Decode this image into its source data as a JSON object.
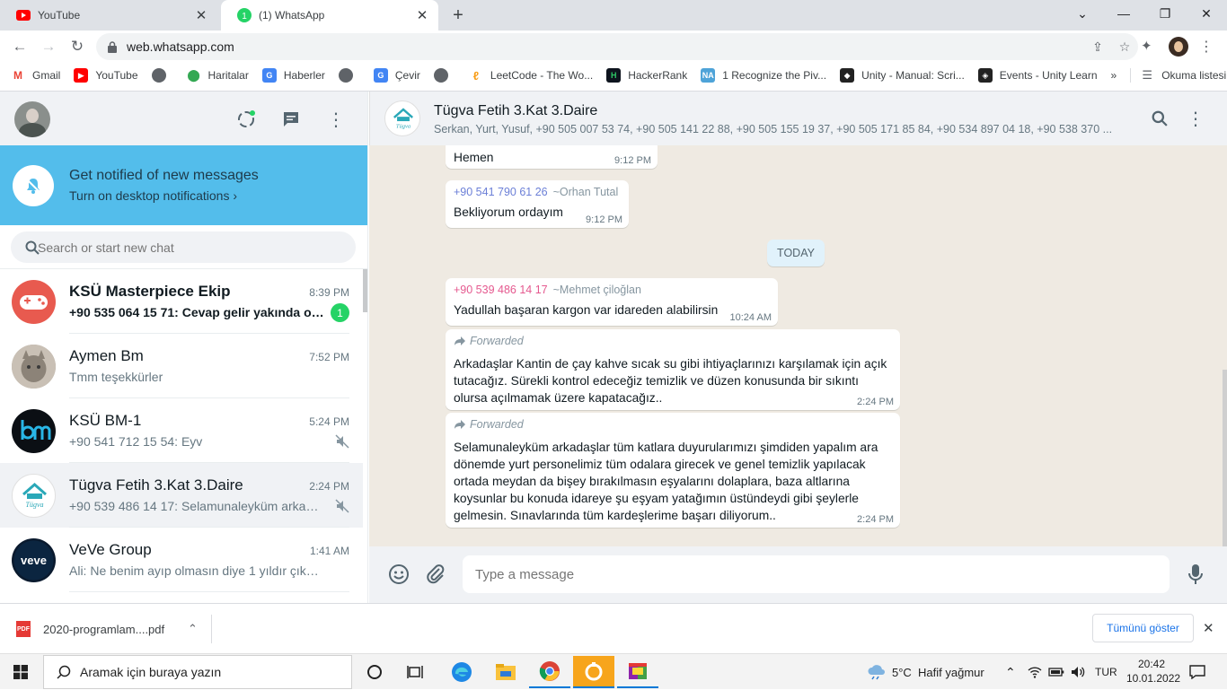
{
  "browser": {
    "tabs": [
      {
        "title": "YouTube",
        "active": false
      },
      {
        "title": "(1) WhatsApp",
        "active": true
      }
    ],
    "url": "web.whatsapp.com",
    "bookmarks": [
      {
        "label": "Gmail",
        "icon": "gmail-icon"
      },
      {
        "label": "YouTube",
        "icon": "youtube-icon"
      },
      {
        "label": "",
        "icon": "globe-icon"
      },
      {
        "label": "Haritalar",
        "icon": "maps-icon"
      },
      {
        "label": "Haberler",
        "icon": "news-icon"
      },
      {
        "label": "",
        "icon": "globe-icon"
      },
      {
        "label": "Çevir",
        "icon": "translate-icon"
      },
      {
        "label": "",
        "icon": "globe-icon"
      },
      {
        "label": "LeetCode - The Wo...",
        "icon": "leetcode-icon"
      },
      {
        "label": "HackerRank",
        "icon": "hackerrank-icon"
      },
      {
        "label": "1 Recognize the Piv...",
        "icon": "na-icon"
      },
      {
        "label": "Unity - Manual: Scri...",
        "icon": "unity-icon"
      },
      {
        "label": "Events - Unity Learn",
        "icon": "unity-learn-icon"
      }
    ],
    "more_bookmarks": "»",
    "reading_list": "Okuma listesi"
  },
  "whatsapp": {
    "notification": {
      "title": "Get notified of new messages",
      "subtitle": "Turn on desktop notifications ›"
    },
    "search_placeholder": "Search or start new chat",
    "chats": [
      {
        "name": "KSÜ Masterpiece Ekip",
        "time": "8:39 PM",
        "preview": "+90 535 064 15 71: Cevap gelir yakında o z...",
        "unread": "1",
        "bold": true,
        "muted": false,
        "avatar": "gamepad"
      },
      {
        "name": "Aymen Bm",
        "time": "7:52 PM",
        "preview": "Tmm teşekkürler",
        "unread": "",
        "bold": false,
        "muted": false,
        "avatar": "cat"
      },
      {
        "name": "KSÜ BM-1",
        "time": "5:24 PM",
        "preview": "+90 541 712 15 54: Eyv",
        "unread": "",
        "bold": false,
        "muted": true,
        "avatar": "bm"
      },
      {
        "name": "Tügva Fetih 3.Kat 3.Daire",
        "time": "2:24 PM",
        "preview": "+90 539 486 14 17: Selamunaleyküm arkadaş...",
        "unread": "",
        "bold": false,
        "muted": true,
        "avatar": "house",
        "selected": true
      },
      {
        "name": "VeVe Group",
        "time": "1:41 AM",
        "preview": "Ali: Ne benim ayıp olmasın diye 1 yıldır çıkmadı...",
        "unread": "",
        "bold": false,
        "muted": false,
        "avatar": "veve"
      }
    ],
    "conversation": {
      "name": "Tügva Fetih 3.Kat 3.Daire",
      "members": "Serkan, Yurt, Yusuf, +90 505 007 53 74, +90 505 141 22 88, +90 505 155 19 37, +90 505 171 85 84, +90 534 897 04 18, +90 538 370 ...",
      "day_divider": "TODAY",
      "messages": [
        {
          "sender": "",
          "alias": "",
          "text": "Hemen",
          "time": "9:12 PM",
          "forwarded": false
        },
        {
          "sender": "+90 541 790 61 26",
          "alias": "~Orhan Tutal",
          "text": "Bekliyorum ordayım",
          "time": "9:12 PM",
          "forwarded": false,
          "sender_color": "#6b7fd7"
        },
        {
          "sender": "+90 539 486 14 17",
          "alias": "~Mehmet çiloğlan",
          "text": "Yadullah başaran kargon var idareden alabilirsin",
          "time": "10:24 AM",
          "forwarded": false,
          "sender_color": "#e5598f"
        },
        {
          "sender": "",
          "alias": "",
          "fwd_label": "Forwarded",
          "text": "Arkadaşlar Kantin de çay kahve sıcak su gibi ihtiyaçlarınızı karşılamak için açık tutacağız. Sürekli kontrol edeceğiz temizlik ve düzen konusunda bir sıkıntı olursa açılmamak üzere kapatacağız..",
          "time": "2:24 PM",
          "forwarded": true
        },
        {
          "sender": "",
          "alias": "",
          "fwd_label": "Forwarded",
          "text": "Selamunaleyküm arkadaşlar tüm katlara duyurularımızı şimdiden yapalım ara dönemde yurt personelimiz tüm odalara girecek ve genel temizlik yapılacak ortada meydan da bişey bırakılmasın eşyalarını dolaplara, baza altlarına koysunlar bu konuda  idareye şu eşyam yatağımın üstündeydi gibi şeylerle gelmesin. Sınavlarında tüm kardeşlerime başarı diliyorum..",
          "time": "2:24 PM",
          "forwarded": true
        }
      ],
      "composer_placeholder": "Type a message"
    }
  },
  "downloads": {
    "file": "2020-programlam....pdf",
    "show_all": "Tümünü göster"
  },
  "taskbar": {
    "search_placeholder": "Aramak için buraya yazın",
    "weather": "5°C  Hafif yağmur",
    "language": "TUR",
    "time": "20:42",
    "date": "10.01.2022"
  }
}
